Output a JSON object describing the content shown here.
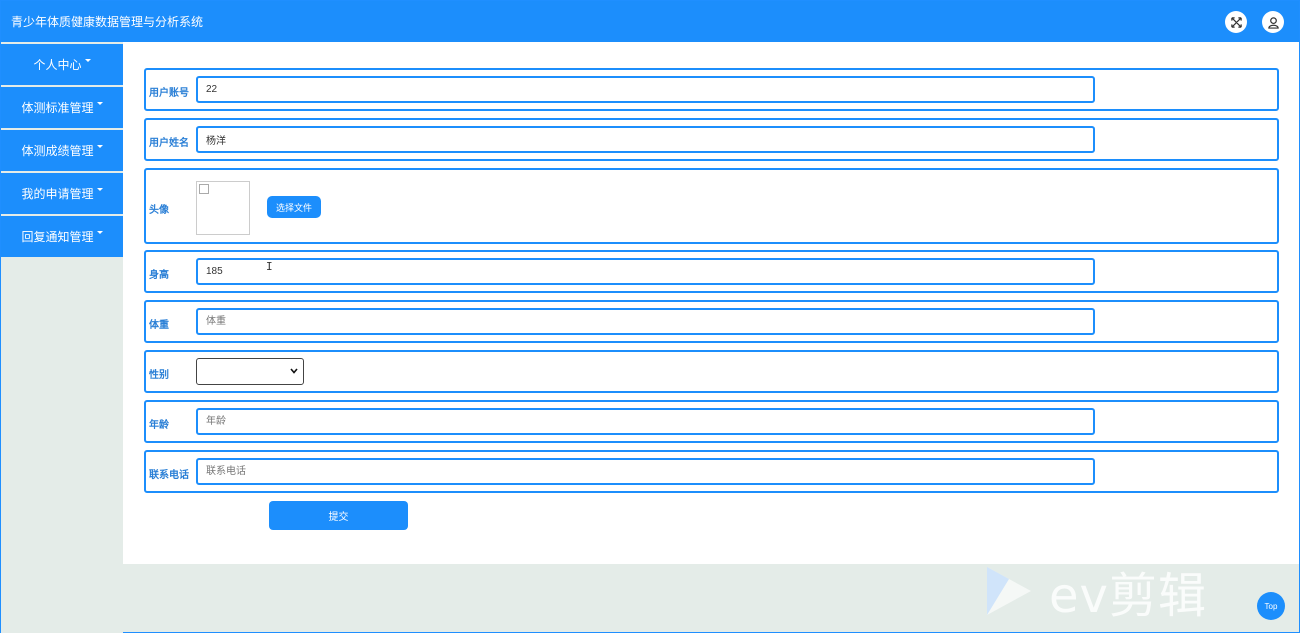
{
  "header": {
    "title": "青少年体质健康数据管理与分析系统",
    "icons": [
      "fullscreen-icon",
      "user-icon"
    ]
  },
  "sidebar": {
    "items": [
      {
        "label": "个人中心"
      },
      {
        "label": "体测标准管理"
      },
      {
        "label": "体测成绩管理"
      },
      {
        "label": "我的申请管理"
      },
      {
        "label": "回复通知管理"
      }
    ]
  },
  "form": {
    "account": {
      "label": "用户账号",
      "value": "22"
    },
    "name": {
      "label": "用户姓名",
      "value": "杨洋"
    },
    "avatar": {
      "label": "头像",
      "button": "选择文件"
    },
    "height": {
      "label": "身高",
      "value": "185"
    },
    "weight": {
      "label": "体重",
      "placeholder": "体重"
    },
    "gender": {
      "label": "性别",
      "value": ""
    },
    "age": {
      "label": "年龄",
      "placeholder": "年龄"
    },
    "phone": {
      "label": "联系电话",
      "placeholder": "联系电话"
    },
    "submit": "提交"
  },
  "watermark": "ev剪辑",
  "top_button": "Top",
  "colors": {
    "accent": "#1c8efc",
    "background": "#e4ece8"
  }
}
